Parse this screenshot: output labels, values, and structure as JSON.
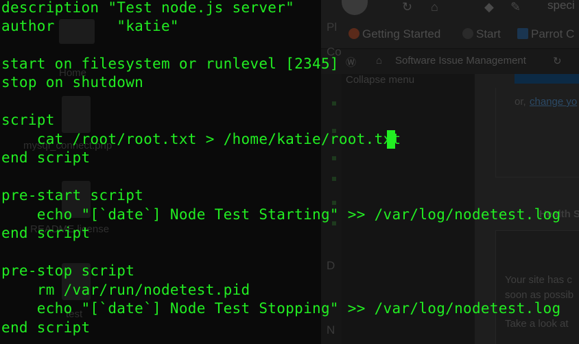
{
  "terminal": {
    "text_color": "#22ee22",
    "background_color": "#0a0a0a",
    "lines": [
      "description \"Test node.js server\"",
      "author       \"katie\"",
      "",
      "start on filesystem or runlevel [2345]",
      "stop on shutdown",
      "",
      "script",
      "    cat /root/root.txt > /home/katie/root.txt",
      "end script",
      "",
      "pre-start script",
      "    echo \"[`date`] Node Test Starting\" >> /var/log/nodetest.log",
      "end script",
      "",
      "pre-stop script",
      "    rm /var/run/nodetest.pid",
      "    echo \"[`date`] Node Test Stopping\" >> /var/log/nodetest.log",
      "end script"
    ],
    "cursor_line": 7
  },
  "background_desktop": {
    "icons": [
      {
        "label": "Home",
        "icon": "home-folder-icon"
      },
      {
        "label": "mysql_connect.php",
        "icon": "document-icon"
      },
      {
        "label": "README.license",
        "icon": "document-icon"
      },
      {
        "label": "test",
        "icon": "document-icon"
      }
    ]
  },
  "background_browser": {
    "tab_title": "speci",
    "bookmarks": [
      "Getting Started",
      "Start",
      "Parrot C"
    ],
    "wp_admin_bar": [
      "Software Issue Management"
    ],
    "collapse_menu": "Collapse menu",
    "panel_link": "change yo",
    "panel_prefix": "or,",
    "health_heading": "Health St",
    "health_text": [
      "Your site has c",
      "soon as possib",
      "Take a look at"
    ],
    "side_labels": [
      "Pl",
      "Co",
      "D",
      "N"
    ]
  }
}
